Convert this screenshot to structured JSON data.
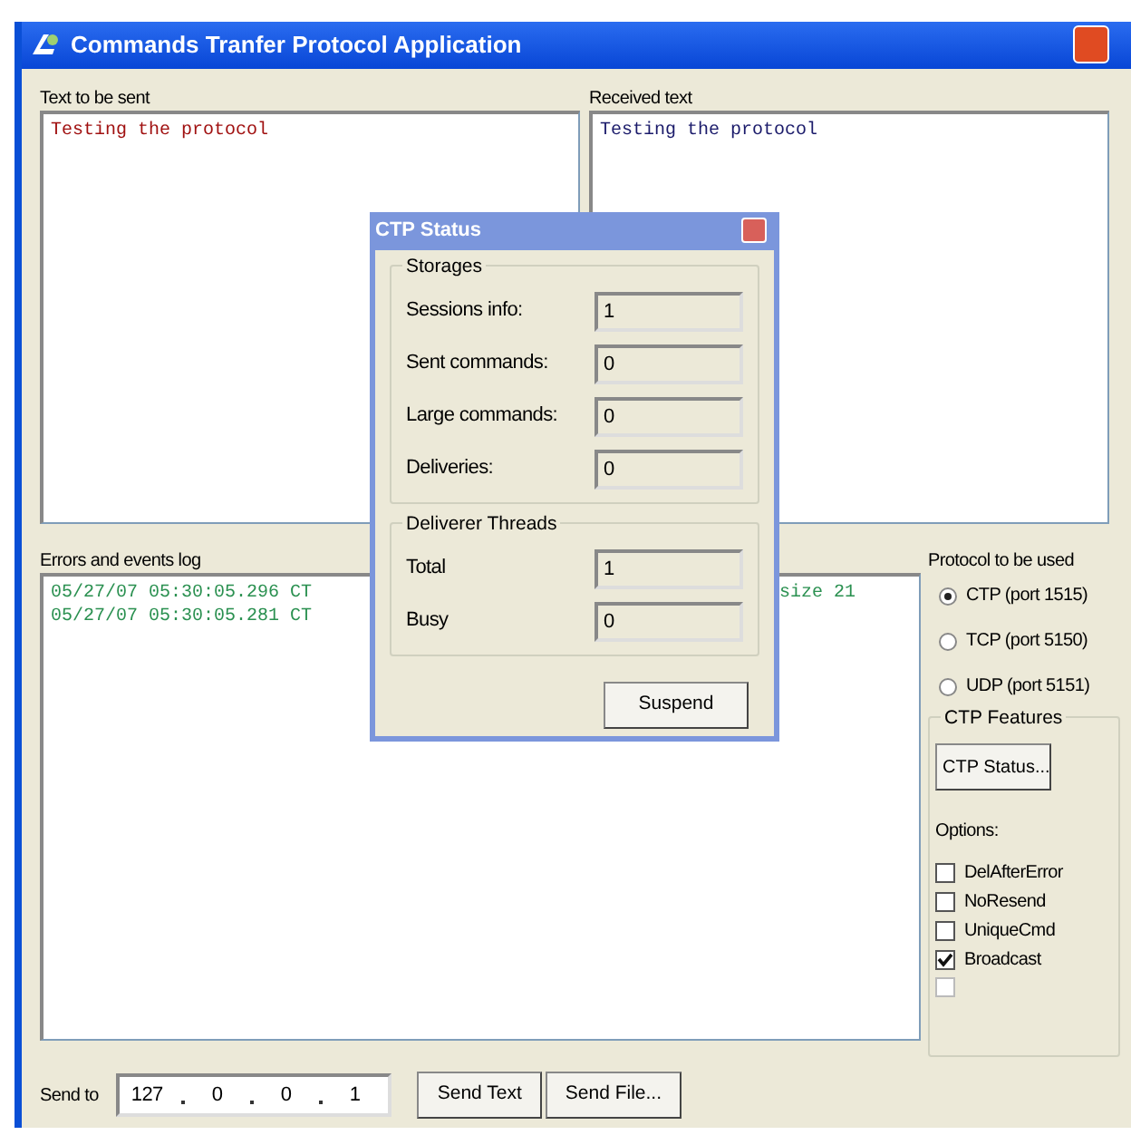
{
  "window": {
    "title": "Commands Tranfer Protocol Application"
  },
  "text_to_send": {
    "label": "Text to be sent",
    "value": "Testing the protocol"
  },
  "received_text": {
    "label": "Received text",
    "value": "Testing the protocol"
  },
  "log": {
    "label": "Errors and events log",
    "lines": [
      {
        "left": "05/27/07 05:30:05.296 CT",
        "right": "size 21"
      },
      {
        "left": "05/27/07 05:30:05.281 CT"
      }
    ]
  },
  "protocol": {
    "label": "Protocol to be used",
    "options": [
      {
        "label": "CTP (port 1515)",
        "selected": true
      },
      {
        "label": "TCP (port 5150)",
        "selected": false
      },
      {
        "label": "UDP (port 5151)",
        "selected": false
      }
    ]
  },
  "ctp_features": {
    "label": "CTP Features",
    "status_button": "CTP Status...",
    "options_label": "Options:",
    "options": [
      {
        "label": "DelAfterError",
        "checked": false,
        "disabled": false
      },
      {
        "label": "NoResend",
        "checked": false,
        "disabled": false
      },
      {
        "label": "UniqueCmd",
        "checked": false,
        "disabled": false
      },
      {
        "label": "Broadcast",
        "checked": true,
        "disabled": false
      },
      {
        "checked": false,
        "disabled": true
      }
    ]
  },
  "send_to": {
    "label": "Send to",
    "ip": [
      "127",
      "0",
      "0",
      "1"
    ],
    "buttons": [
      "Send Text",
      "Send File..."
    ]
  },
  "dialog": {
    "title": "CTP Status",
    "groups": [
      {
        "label": "Storages",
        "fields": [
          {
            "label": "Sessions info:",
            "value": "1"
          },
          {
            "label": "Sent commands:",
            "value": "0"
          },
          {
            "label": "Large commands:",
            "value": "0"
          },
          {
            "label": "Deliveries:",
            "value": "0"
          }
        ]
      },
      {
        "label": "Deliverer Threads",
        "fields": [
          {
            "label": "Total",
            "value": "1"
          },
          {
            "label": "Busy",
            "value": "0"
          }
        ]
      }
    ],
    "button": "Suspend"
  }
}
